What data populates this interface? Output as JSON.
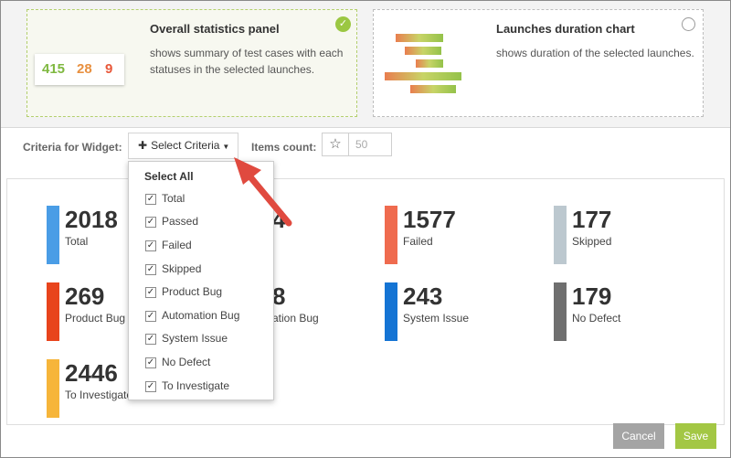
{
  "widgets": [
    {
      "title": "Overall statistics panel",
      "description": "shows summary of test cases with each statuses in the selected launches.",
      "selected": true,
      "preview": [
        "415",
        "28",
        "9"
      ]
    },
    {
      "title": "Launches duration chart",
      "description": "shows duration of the selected launches.",
      "selected": false
    }
  ],
  "criteria": {
    "label": "Criteria for Widget:",
    "select_label": "Select Criteria",
    "items_count_label": "Items count:",
    "items_count_placeholder": "50"
  },
  "dropdown": {
    "select_all": "Select All",
    "items": [
      "Total",
      "Passed",
      "Failed",
      "Skipped",
      "Product Bug",
      "Automation Bug",
      "System Issue",
      "No Defect",
      "To Investigate"
    ]
  },
  "stats": [
    {
      "value": "2018",
      "label": "Total",
      "color": "#4a9de6"
    },
    {
      "value": "",
      "label": "",
      "color": ""
    },
    {
      "value": "1577",
      "label": "Failed",
      "color": "#ef6b4f"
    },
    {
      "value": "177",
      "label": "Skipped",
      "color": "#bcc8cf"
    },
    {
      "value": "269",
      "label": "Product Bug",
      "color": "#e8441c"
    },
    {
      "value": "",
      "label": "ation Bug",
      "color": ""
    },
    {
      "value": "243",
      "label": "System Issue",
      "color": "#1474d4"
    },
    {
      "value": "179",
      "label": "No Defect",
      "color": "#6f6f6f"
    },
    {
      "value": "2446",
      "label": "To Investigate",
      "color": "#f6b53a"
    }
  ],
  "hidden_digits": {
    "passed_fragment": "4",
    "automation_fragment": "8"
  },
  "buttons": {
    "cancel": "Cancel",
    "save": "Save"
  },
  "colors": {
    "accent_green": "#9bc742",
    "arrow": "#e04a3f"
  }
}
